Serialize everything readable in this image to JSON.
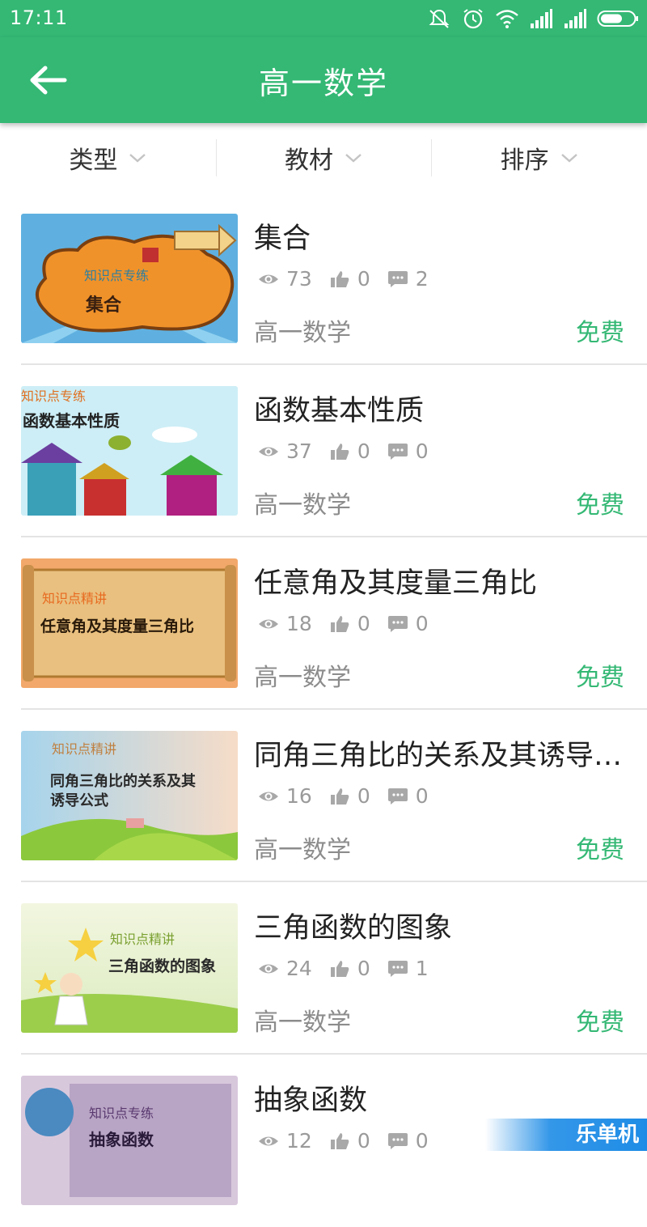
{
  "status_bar": {
    "time": "17:11"
  },
  "header": {
    "title": "高一数学"
  },
  "filters": [
    {
      "label": "类型"
    },
    {
      "label": "教材"
    },
    {
      "label": "排序"
    }
  ],
  "items": [
    {
      "title": "集合",
      "views": "73",
      "likes": "0",
      "comments": "2",
      "subject": "高一数学",
      "price": "免费",
      "thumb": {
        "tag": "知识点专练",
        "caption": "集合"
      }
    },
    {
      "title": "函数基本性质",
      "views": "37",
      "likes": "0",
      "comments": "0",
      "subject": "高一数学",
      "price": "免费",
      "thumb": {
        "tag": "知识点专练",
        "caption": "函数基本性质"
      }
    },
    {
      "title": "任意角及其度量三角比",
      "views": "18",
      "likes": "0",
      "comments": "0",
      "subject": "高一数学",
      "price": "免费",
      "thumb": {
        "tag": "知识点精讲",
        "caption": "任意角及其度量三角比"
      }
    },
    {
      "title": "同角三角比的关系及其诱导公式",
      "views": "16",
      "likes": "0",
      "comments": "0",
      "subject": "高一数学",
      "price": "免费",
      "thumb": {
        "tag": "知识点精讲",
        "caption_line1": "同角三角比的关系及其",
        "caption_line2": "诱导公式"
      }
    },
    {
      "title": "三角函数的图象",
      "views": "24",
      "likes": "0",
      "comments": "1",
      "subject": "高一数学",
      "price": "免费",
      "thumb": {
        "tag": "知识点精讲",
        "caption": "三角函数的图象"
      }
    },
    {
      "title": "抽象函数",
      "views": "12",
      "likes": "0",
      "comments": "0",
      "subject": "",
      "price": "",
      "thumb": {
        "tag": "知识点专练",
        "caption": "抽象函数"
      }
    }
  ],
  "watermark": "乐单机",
  "colors": {
    "primary": "#34b874",
    "price": "#34b874",
    "meta": "#9a9a9a"
  },
  "icons": {
    "views": "eye-icon",
    "likes": "thumbs-up-icon",
    "comments": "chat-bubble-icon"
  }
}
